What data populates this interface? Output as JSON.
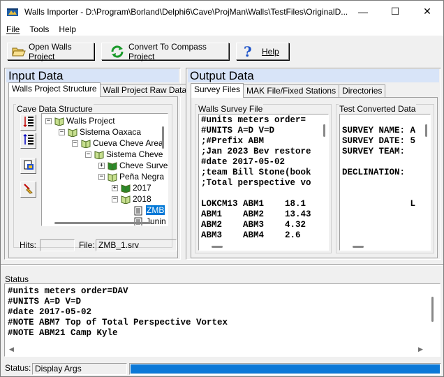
{
  "window": {
    "title": "Walls Importer - D:\\Program\\Borland\\Delphi6\\Cave\\ProjMan\\Walls\\TestFiles\\OriginalD...",
    "minimize": "—",
    "maximize": "☐",
    "close": "✕"
  },
  "menu": {
    "file": "File",
    "tools": "Tools",
    "help": "Help"
  },
  "toolbar": {
    "open_label": "Open Walls Project",
    "convert_label": "Convert To Compass Project",
    "help_label": "Help"
  },
  "input": {
    "header": "Input Data",
    "tabs": [
      "Walls Project Structure",
      "Wall Project Raw Data"
    ],
    "group_label": "Cave Data Structure",
    "tree": [
      {
        "label": "Walls Project",
        "expander": "⊟",
        "level": 0,
        "icon": "book-icon"
      },
      {
        "label": "Sistema Oaxaca",
        "expander": "⊟",
        "level": 1,
        "icon": "book-icon"
      },
      {
        "label": "Cueva Cheve Area",
        "expander": "⊟",
        "level": 2,
        "icon": "book-icon"
      },
      {
        "label": "Sistema Cheve",
        "expander": "⊟",
        "level": 3,
        "icon": "book-icon"
      },
      {
        "label": "Cheve Surve",
        "expander": "⊞",
        "level": 4,
        "icon": "green-book-icon"
      },
      {
        "label": "Peña Negra",
        "expander": "⊟",
        "level": 4,
        "icon": "book-icon"
      },
      {
        "label": "2017",
        "expander": "⊞",
        "level": 5,
        "icon": "green-book-icon"
      },
      {
        "label": "2018",
        "expander": "⊟",
        "level": 5,
        "icon": "book-icon"
      },
      {
        "label": "ZMB",
        "expander": "",
        "level": 6,
        "icon": "file-icon",
        "selected": true
      },
      {
        "label": "Junin",
        "expander": "",
        "level": 6,
        "icon": "file-icon"
      }
    ],
    "hits_label": "Hits:",
    "hits_value": "",
    "file_label": "File:",
    "file_value": "ZMB_1.srv"
  },
  "output": {
    "header": "Output Data",
    "tabs": [
      "Survey Files",
      "MAK File/Fixed Stations",
      "Directories"
    ],
    "walls_label": "Walls Survey File",
    "walls_lines": [
      "#units meters order=",
      "#UNITS A=D V=D",
      ";#Prefix ABM",
      ";Jan 2023 Bev restore",
      "#date 2017-05-02",
      ";team Bill Stone(book",
      ";Total perspective vo",
      "",
      "LOKCM13 ABM1    18.1",
      "ABM1    ABM2    13.43",
      "ABM2    ABM3    4.32",
      "ABM3    ABM4    2.6"
    ],
    "converted_label": "Test Converted Data",
    "converted_lines": [
      "",
      "SURVEY NAME: A",
      "SURVEY DATE: 5",
      "SURVEY TEAM:",
      "",
      "DECLINATION:",
      "",
      "",
      "             L"
    ]
  },
  "status": {
    "label": "Status",
    "lines": [
      "#units meters order=DAV",
      "#UNITS A=D V=D",
      "#date 2017-05-02",
      "#NOTE ABM7 Top of Total Perspective Vortex",
      "#NOTE ABM21 Camp Kyle"
    ],
    "bar_label": "Status:",
    "bar_value": "Display Args",
    "progress": 1.0
  },
  "colors": {
    "header_bg": "#d8e4f8",
    "selection": "#0078d7",
    "progress": "#0b78d7"
  }
}
